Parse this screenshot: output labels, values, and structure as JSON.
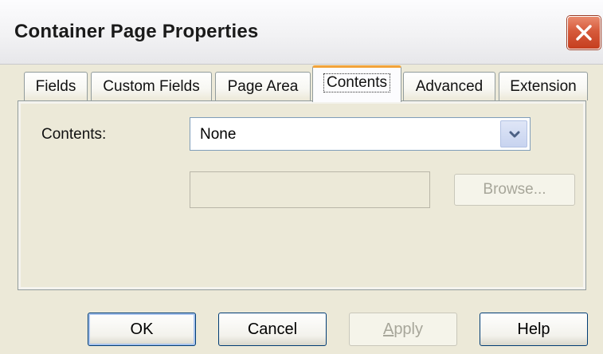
{
  "window": {
    "title": "Container Page Properties"
  },
  "tabs": [
    {
      "label": "Fields",
      "active": false
    },
    {
      "label": "Custom Fields",
      "active": false
    },
    {
      "label": "Page Area",
      "active": false
    },
    {
      "label": "Contents",
      "active": true
    },
    {
      "label": "Advanced",
      "active": false
    },
    {
      "label": "Extension",
      "active": false
    }
  ],
  "contents_tab": {
    "contents_label": "Contents:",
    "contents_select_value": "None",
    "path_value": "",
    "browse_label": "Browse..."
  },
  "buttons": {
    "ok": "OK",
    "cancel": "Cancel",
    "apply_mnemonic": "A",
    "apply_rest": "pply",
    "help": "Help"
  },
  "icons": {
    "close": "close-x-icon",
    "dropdown": "chevron-down-icon"
  },
  "colors": {
    "dialog_bg": "#ece9d8",
    "active_tab_accent": "#f2a33a",
    "close_button": "#d65a3b",
    "button_border": "#003c74"
  }
}
